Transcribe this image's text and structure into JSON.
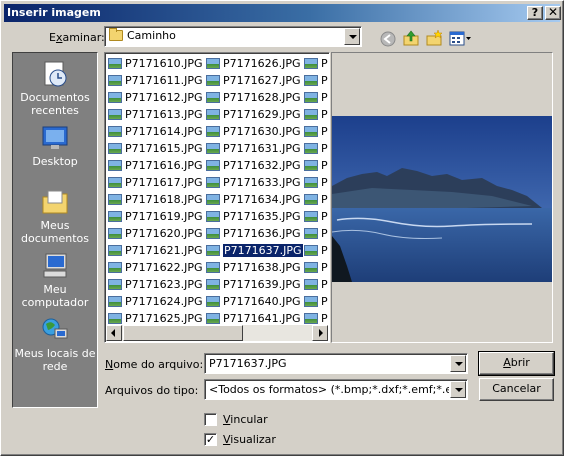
{
  "window": {
    "title": "Inserir imagem",
    "help_label": "?",
    "close_label": "✕"
  },
  "lookin": {
    "label_prefix": "",
    "label_access": "x",
    "label_rest": "aminar:",
    "label_first": "E",
    "value": "Caminho"
  },
  "toolbar": {
    "icons": [
      "back-icon",
      "up-folder-icon",
      "new-folder-icon",
      "views-menu-icon"
    ]
  },
  "places": [
    {
      "label": "Documentos recentes",
      "icon": "recent-documents-icon"
    },
    {
      "label": "Desktop",
      "icon": "desktop-icon"
    },
    {
      "label": "Meus documentos",
      "icon": "my-documents-icon"
    },
    {
      "label": "Meu computador",
      "icon": "my-computer-icon"
    },
    {
      "label": "Meus locais de rede",
      "icon": "network-places-icon"
    }
  ],
  "files": {
    "col1": [
      "P7171610.JPG",
      "P7171611.JPG",
      "P7171612.JPG",
      "P7171613.JPG",
      "P7171614.JPG",
      "P7171615.JPG",
      "P7171616.JPG",
      "P7171617.JPG",
      "P7171618.JPG",
      "P7171619.JPG",
      "P7171620.JPG",
      "P7171621.JPG",
      "P7171622.JPG",
      "P7171623.JPG",
      "P7171624.JPG",
      "P7171625.JPG"
    ],
    "col2": [
      "P7171626.JPG",
      "P7171627.JPG",
      "P7171628.JPG",
      "P7171629.JPG",
      "P7171630.JPG",
      "P7171631.JPG",
      "P7171632.JPG",
      "P7171633.JPG",
      "P7171634.JPG",
      "P7171635.JPG",
      "P7171636.JPG",
      "P7171637.JPG",
      "P7171638.JPG",
      "P7171639.JPG",
      "P7171640.JPG",
      "P7171641.JPG"
    ],
    "col3": [
      "P",
      "P",
      "P",
      "P",
      "P",
      "P",
      "P",
      "P",
      "P",
      "P",
      "P",
      "P",
      "P",
      "P",
      "P",
      "P"
    ],
    "selected": "P7171637.JPG"
  },
  "filename": {
    "label_first": "N",
    "label_rest": "ome do arquivo:",
    "value": "P7171637.JPG"
  },
  "filetype": {
    "label": "Arquivos do tipo:",
    "value": "<Todos os formatos> (*.bmp;*.dxf;*.emf;*.eps;*.gif;*.j"
  },
  "buttons": {
    "open_first": "A",
    "open_rest": "brir",
    "cancel": "Cancelar"
  },
  "options": {
    "link_first": "V",
    "link_rest": "incular",
    "link_checked": false,
    "preview_first": "V",
    "preview_rest": "isualizar",
    "preview_checked": true
  },
  "colors": {
    "titlebar_start": "#0a246a",
    "titlebar_end": "#a6caf0",
    "dialog_bg": "#d4d0c8",
    "places_bg": "#808080",
    "selection": "#0a246a"
  }
}
